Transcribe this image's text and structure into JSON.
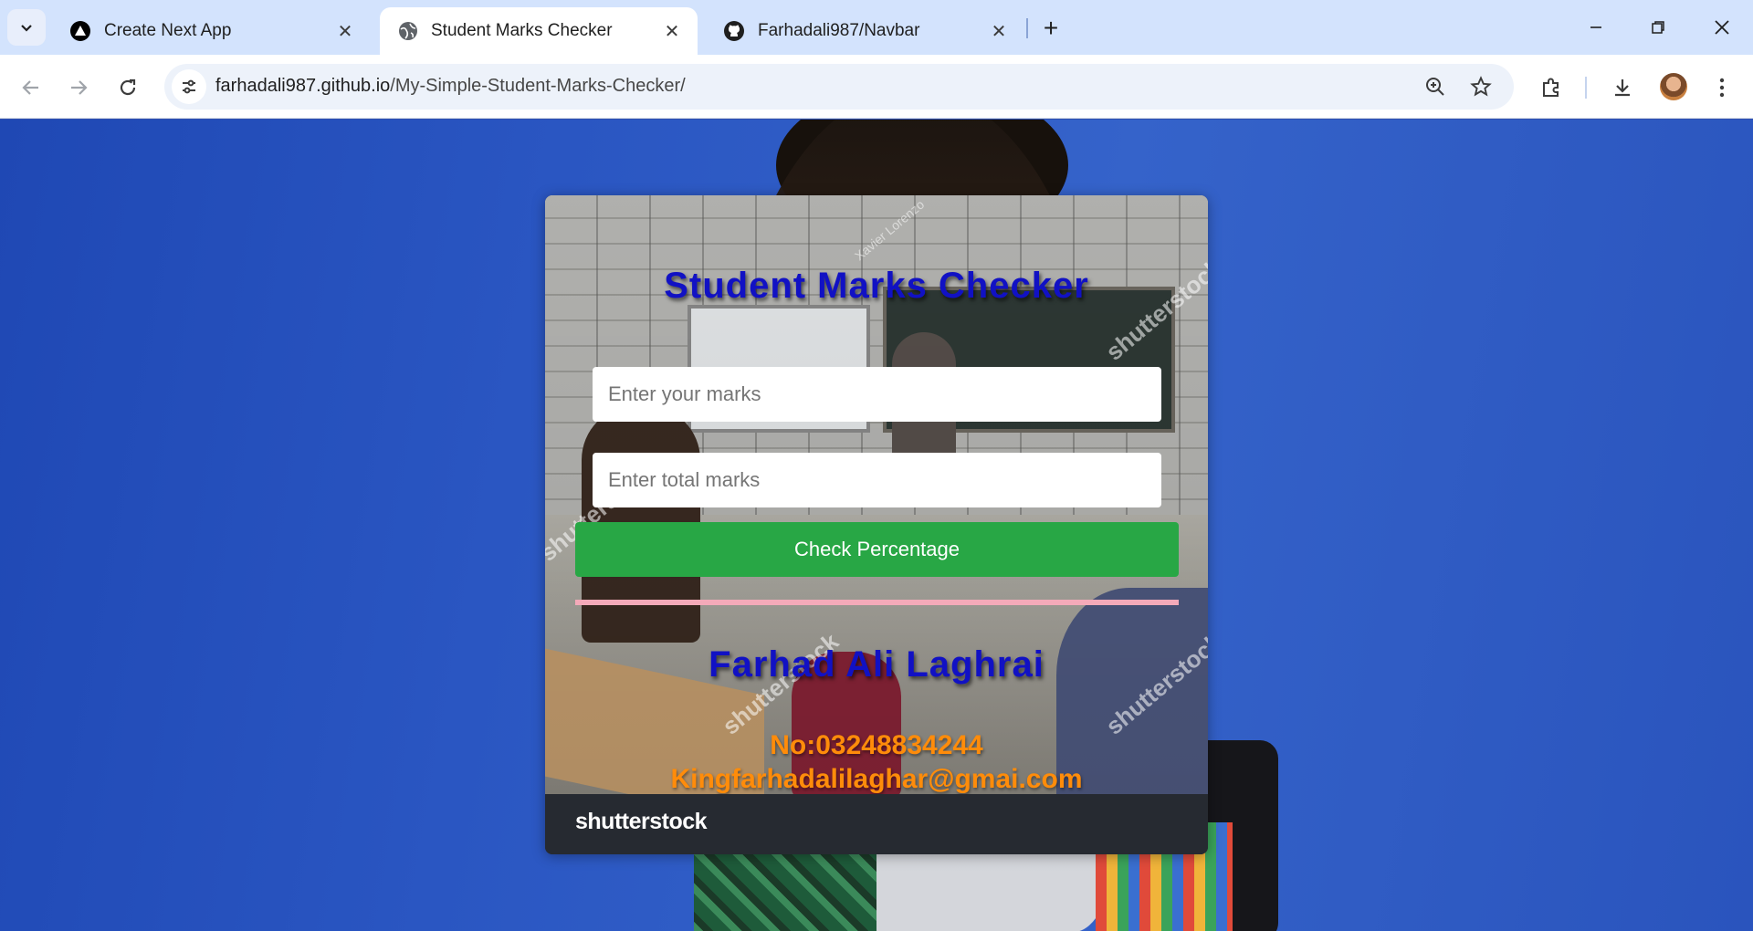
{
  "browser": {
    "tabs": [
      {
        "title": "Create Next App",
        "icon": "nextjs-icon",
        "active": false
      },
      {
        "title": "Student Marks Checker",
        "icon": "globe-icon",
        "active": true
      },
      {
        "title": "Farhadali987/Navbar",
        "icon": "github-icon",
        "active": false
      }
    ],
    "url_host": "farhadali987.github.io",
    "url_path": "/My-Simple-Student-Marks-Checker/"
  },
  "page": {
    "title": "Student Marks Checker",
    "marks_placeholder": "Enter your marks",
    "total_placeholder": "Enter total marks",
    "button_label": "Check Percentage",
    "author_name": "Farhad Ali Laghrai",
    "phone": "No:03248834244",
    "email": "Kingfarhadalilaghar@gmai.com",
    "footer_brand": "shutterstock",
    "watermarks": [
      "Xavier Lorenzo",
      "shutterstock",
      "shutterstock",
      "shutterstock",
      "shutterstock"
    ]
  },
  "colors": {
    "accent_button": "#28a745",
    "title_text": "#1111c4",
    "contact_text": "#ff8c0a",
    "divider": "#f4aab9"
  }
}
